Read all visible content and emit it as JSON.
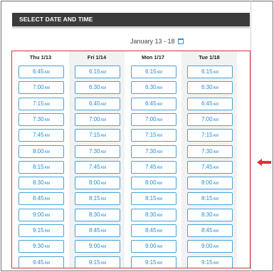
{
  "header": {
    "title": "SELECT DATE AND TIME"
  },
  "date_range": "January 13 - 18",
  "days": [
    {
      "label": "Thu 1/13",
      "slots": [
        "6:45",
        "7:00",
        "7:15",
        "7:30",
        "7:45",
        "8:00",
        "8:15",
        "8:30",
        "8:45",
        "9:00",
        "9:15",
        "9:30",
        "9:45"
      ]
    },
    {
      "label": "Fri 1/14",
      "slots": [
        "6:15",
        "6:30",
        "6:45",
        "7:00",
        "7:15",
        "7:30",
        "7:45",
        "8:00",
        "8:15",
        "8:30",
        "8:45",
        "9:00",
        "9:15"
      ]
    },
    {
      "label": "Mon 1/17",
      "slots": [
        "6:15",
        "6:30",
        "6:45",
        "7:00",
        "7:15",
        "7:30",
        "7:45",
        "8:00",
        "8:15",
        "8:30",
        "8:45",
        "9:00",
        "9:15"
      ]
    },
    {
      "label": "Tue 1/18",
      "slots": [
        "6:15",
        "6:30",
        "6:45",
        "7:00",
        "7:15",
        "7:30",
        "7:45",
        "8:00",
        "8:15",
        "8:30",
        "8:45",
        "9:00",
        "9:15"
      ]
    }
  ],
  "slot_suffix": "AM",
  "colors": {
    "header_bg": "#3b3b3b",
    "slot_border": "#45a3d9",
    "slot_text": "#2b8cc9",
    "highlight": "#e0303a"
  },
  "icons": {
    "calendar": "calendar-icon",
    "arrow": "arrow-left-icon"
  }
}
